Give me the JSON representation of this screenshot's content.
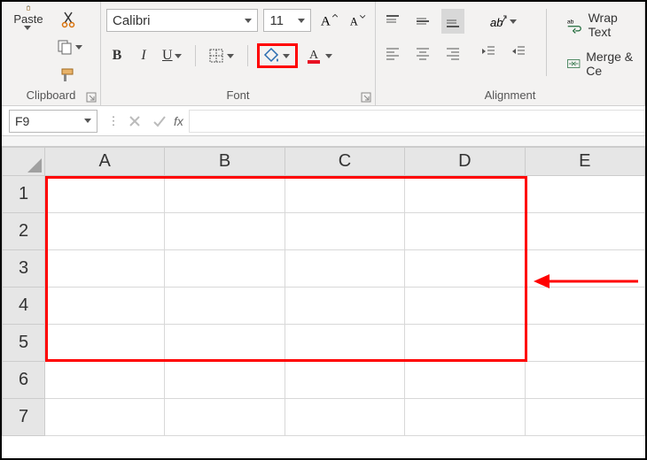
{
  "clipboard": {
    "paste_label": "Paste",
    "group_label": "Clipboard"
  },
  "font": {
    "name": "Calibri",
    "size": "11",
    "group_label": "Font",
    "bold": "B",
    "italic": "I",
    "underline": "U"
  },
  "alignment": {
    "group_label": "Alignment",
    "wrap_label": "Wrap Text",
    "merge_label": "Merge & Ce"
  },
  "namebox": {
    "ref": "F9"
  },
  "formula": {
    "fx": "fx"
  },
  "columns": [
    "A",
    "B",
    "C",
    "D",
    "E"
  ],
  "rows": [
    "1",
    "2",
    "3",
    "4",
    "5",
    "6",
    "7"
  ]
}
